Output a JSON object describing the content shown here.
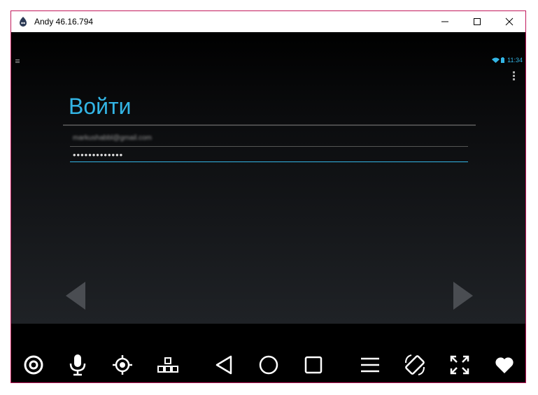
{
  "window": {
    "title": "Andy 46.16.794"
  },
  "status_bar": {
    "time": "11:34",
    "icons": [
      "debug-icon",
      "wifi-icon",
      "battery-icon",
      "overflow-menu-icon"
    ]
  },
  "login": {
    "heading": "Войти",
    "email_value": "markushabbl@gmail.com",
    "password_value": "•••••••••••••"
  },
  "colors": {
    "accent": "#33b5e5",
    "window_border": "#c2185b"
  },
  "toolbar": {
    "items": [
      "camera-icon",
      "microphone-icon",
      "gps-icon",
      "keymap-icon",
      "back-icon",
      "home-icon",
      "recents-icon",
      "menu-icon",
      "rotate-icon",
      "fullscreen-icon",
      "favorite-icon"
    ]
  }
}
